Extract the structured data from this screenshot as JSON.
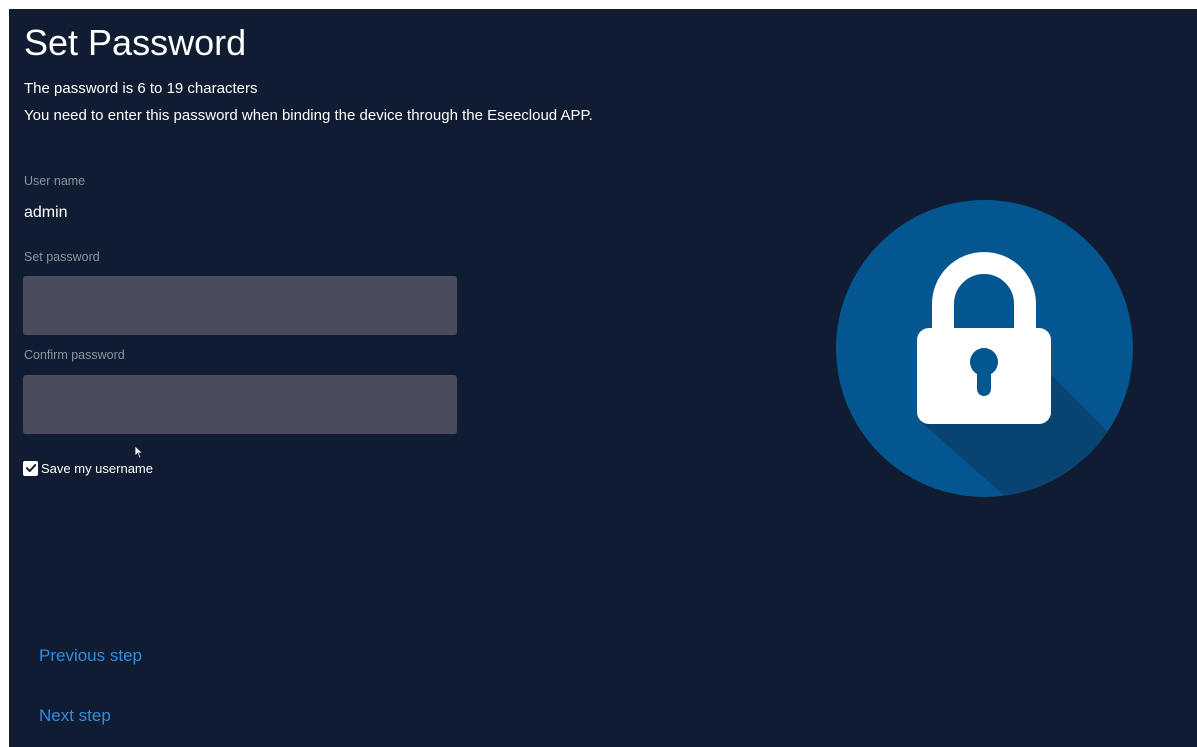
{
  "page": {
    "title": "Set Password",
    "description_line1": "The password is 6 to 19 characters",
    "description_line2": "You need to enter this password when binding the device through the Eseecloud APP."
  },
  "form": {
    "username_label": "User name",
    "username_value": "admin",
    "set_password_label": "Set password",
    "set_password_value": "",
    "confirm_password_label": "Confirm password",
    "confirm_password_value": "",
    "save_username_label": "Save my username",
    "save_username_checked": true
  },
  "navigation": {
    "previous_label": "Previous step",
    "next_label": "Next step"
  },
  "illustration": {
    "icon": "padlock-icon",
    "circle_color": "#03568f",
    "shadow_color": "#0a3f6c",
    "lock_color": "#ffffff"
  },
  "colors": {
    "background": "#101c31",
    "link": "#2f8ee2",
    "input_background": "#4a4b5c",
    "label_text": "#8c93a1"
  }
}
